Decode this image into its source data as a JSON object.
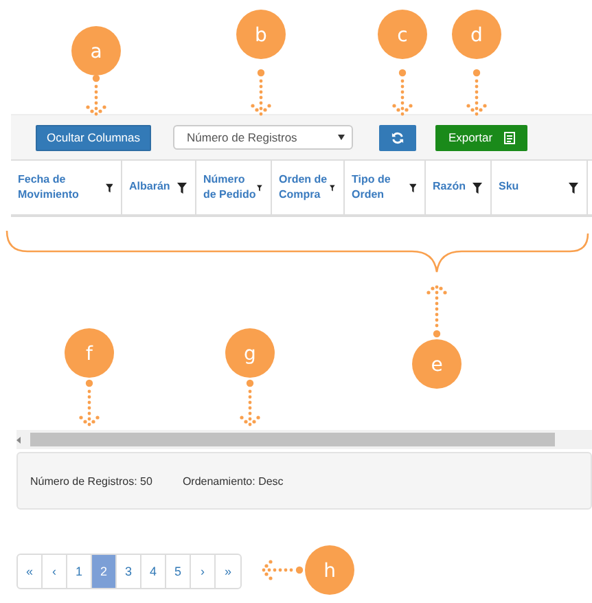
{
  "toolbar": {
    "hide_columns_button": "Ocultar Columnas",
    "records_select": {
      "placeholder": "Número de Registros"
    },
    "export_button": "Exportar"
  },
  "table": {
    "columns": [
      {
        "label": "Fecha de Movimiento"
      },
      {
        "label": "Albarán"
      },
      {
        "label": "Número de Pedido"
      },
      {
        "label": "Orden de Compra"
      },
      {
        "label": "Tipo de Orden"
      },
      {
        "label": "Razón"
      },
      {
        "label": "Sku"
      }
    ]
  },
  "footer": {
    "record_count": "Número de Registros: 50",
    "sort_order": "Ordenamiento: Desc"
  },
  "pagination": [
    {
      "label": "«",
      "selected": false
    },
    {
      "label": "‹",
      "selected": false
    },
    {
      "label": "1",
      "selected": false
    },
    {
      "label": "2",
      "selected": true
    },
    {
      "label": "3",
      "selected": false
    },
    {
      "label": "4",
      "selected": false
    },
    {
      "label": "5",
      "selected": false
    },
    {
      "label": "›",
      "selected": false
    },
    {
      "label": "»",
      "selected": false
    }
  ],
  "callouts": [
    {
      "label": "a"
    },
    {
      "label": "b"
    },
    {
      "label": "c"
    },
    {
      "label": "d"
    },
    {
      "label": "e"
    },
    {
      "label": "f"
    },
    {
      "label": "g"
    },
    {
      "label": "h"
    }
  ]
}
